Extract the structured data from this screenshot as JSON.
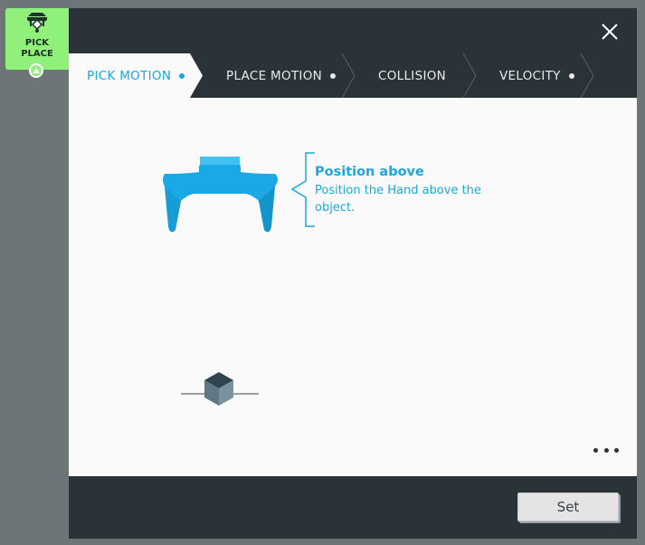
{
  "node": {
    "label": "PICK\nPLACE",
    "icon": "pick-place-icon",
    "color": "#8ff07a"
  },
  "tabs": [
    {
      "label": "PICK MOTION",
      "active": true
    },
    {
      "label": "PLACE MOTION",
      "active": false
    },
    {
      "label": "COLLISION",
      "active": false
    },
    {
      "label": "VELOCITY",
      "active": false
    }
  ],
  "instruction": {
    "title": "Position above",
    "text": "Position the Hand above the object."
  },
  "footer": {
    "set_label": "Set"
  },
  "colors": {
    "accent": "#1ea6d8",
    "header": "#293338",
    "gripper": "#1aa9e6"
  }
}
